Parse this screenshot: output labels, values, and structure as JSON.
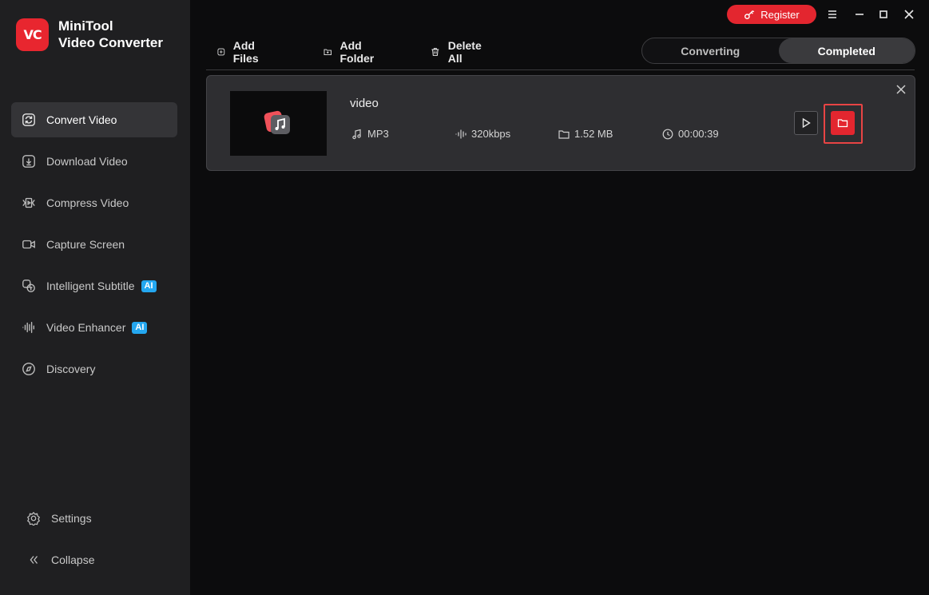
{
  "app": {
    "logo_text": "VC",
    "brand_line1": "MiniTool",
    "brand_line2": "Video Converter"
  },
  "titlebar": {
    "register_label": "Register"
  },
  "sidebar": {
    "items": [
      {
        "label": "Convert Video",
        "icon": "convert-icon",
        "active": true
      },
      {
        "label": "Download Video",
        "icon": "download-icon"
      },
      {
        "label": "Compress Video",
        "icon": "compress-icon"
      },
      {
        "label": "Capture Screen",
        "icon": "camera-icon"
      },
      {
        "label": "Intelligent Subtitle",
        "icon": "subtitle-icon",
        "badge": "AI"
      },
      {
        "label": "Video Enhancer",
        "icon": "waveform-icon",
        "badge": "AI"
      },
      {
        "label": "Discovery",
        "icon": "compass-icon"
      }
    ],
    "bottom": [
      {
        "label": "Settings",
        "icon": "gear-icon"
      },
      {
        "label": "Collapse",
        "icon": "chevron-double-left-icon"
      }
    ]
  },
  "toolbar": {
    "add_files": "Add Files",
    "add_folder": "Add Folder",
    "delete_all": "Delete All"
  },
  "tabs": {
    "converting": "Converting",
    "completed": "Completed",
    "active": "completed"
  },
  "task": {
    "name": "video",
    "format": "MP3",
    "bitrate": "320kbps",
    "size": "1.52 MB",
    "duration": "00:00:39"
  },
  "colors": {
    "accent": "#e3262f",
    "sidebar_bg": "#1f1f21",
    "content_bg": "#0c0c0d",
    "card_bg": "#2e2e31",
    "ai_badge": "#24a7f0"
  }
}
